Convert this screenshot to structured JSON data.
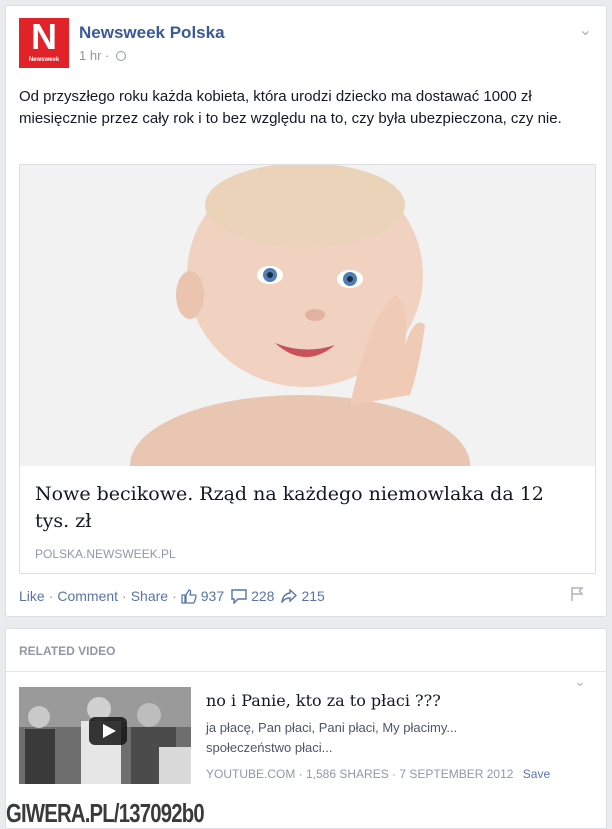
{
  "post": {
    "page_name": "Newsweek Polska",
    "logo_letter": "N",
    "logo_word": "Newsweek",
    "time": "1 hr",
    "text": "Od przyszłego roku każda kobieta, która urodzi dziecko ma dostawać 1000 zł miesięcznie przez cały rok i to bez względu na to, czy była ubezpieczona, czy nie.",
    "link": {
      "title": "Nowe becikowe. Rząd na każdego niemowlaka da 12 tys. zł",
      "domain": "POLSKA.NEWSWEEK.PL"
    },
    "actions": {
      "like": "Like",
      "comment": "Comment",
      "share": "Share",
      "separator": "·",
      "likes_count": "937",
      "comments_count": "228",
      "shares_count": "215"
    }
  },
  "related": {
    "heading": "RELATED VIDEO",
    "video": {
      "title": "no i Panie, kto za to płaci ???",
      "description": "ja płacę, Pan płaci, Pani płaci, My płacimy... społeczeństwo płaci...",
      "meta": "YOUTUBE.COM · 1,586 SHARES · 7 SEPTEMBER 2012",
      "save": "Save"
    }
  },
  "watermark": "GIWERA.PL/137092b0",
  "colors": {
    "brand_red": "#e12229",
    "link_blue": "#3b5998",
    "meta_gray": "#9197a3"
  },
  "icons": [
    "chevron-down-icon",
    "globe-icon",
    "thumbs-up-icon",
    "comment-icon",
    "share-arrow-icon",
    "flag-icon",
    "play-icon"
  ]
}
